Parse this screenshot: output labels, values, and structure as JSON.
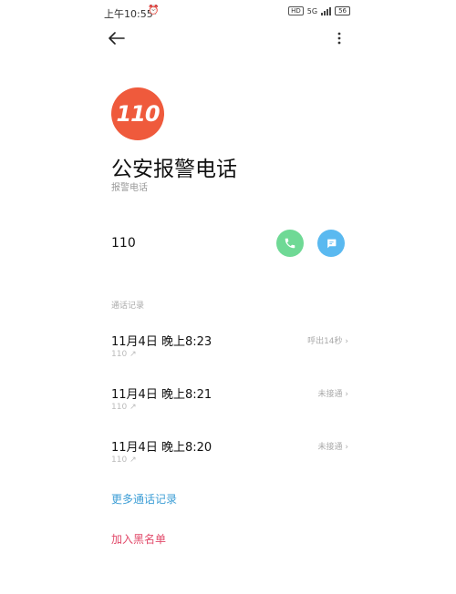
{
  "status_bar": {
    "time": "上午10:55",
    "alarm_icon": "alarm-clock-icon",
    "network": "5G",
    "battery": "56",
    "colors": {
      "text": "#333333"
    }
  },
  "top_bar": {
    "back_icon": "arrow-left-icon",
    "more_icon": "more-vertical-icon"
  },
  "contact": {
    "avatar_text": "110",
    "avatar_color": "#ef5a3c",
    "name": "公安报警电话",
    "subtitle": "报警电话",
    "number": "110"
  },
  "actions": {
    "call_icon": "phone-icon",
    "call_color": "#6fd995",
    "message_icon": "message-icon",
    "message_color": "#5ab9f0"
  },
  "call_log": {
    "section_title": "通话记录",
    "items": [
      {
        "time": "11月4日 晚上8:23",
        "number": "110",
        "direction_icon": "outgoing-arrow-icon",
        "status": "呼出14秒"
      },
      {
        "time": "11月4日 晚上8:21",
        "number": "110",
        "direction_icon": "outgoing-arrow-icon",
        "status": "未接通"
      },
      {
        "time": "11月4日 晚上8:20",
        "number": "110",
        "direction_icon": "outgoing-arrow-icon",
        "status": "未接通"
      }
    ]
  },
  "links": {
    "more_records": "更多通话记录",
    "more_records_color": "#3d9ed6",
    "add_blacklist": "加入黑名单",
    "add_blacklist_color": "#e24b6b"
  }
}
